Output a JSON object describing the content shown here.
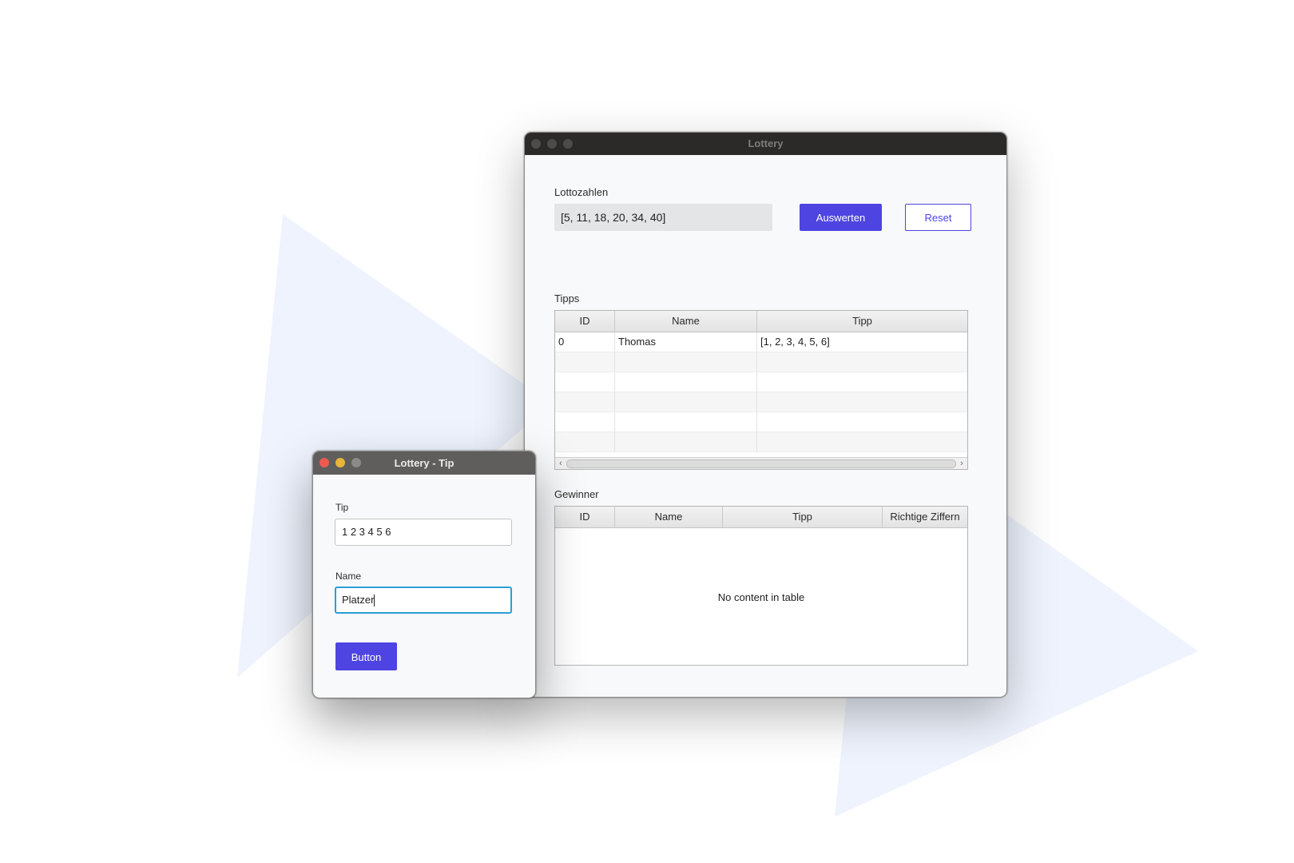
{
  "main_window": {
    "title": "Lottery",
    "lottozahlen_label": "Lottozahlen",
    "lottozahlen_value": "[5, 11, 18, 20, 34, 40]",
    "auswerten_button": "Auswerten",
    "reset_button": "Reset",
    "tipps_label": "Tipps",
    "tipps_table": {
      "columns": [
        "ID",
        "Name",
        "Tipp"
      ],
      "rows": [
        [
          "0",
          "Thomas",
          "[1, 2, 3, 4, 5, 6]"
        ]
      ]
    },
    "gewinner_label": "Gewinner",
    "gewinner_table": {
      "columns": [
        "ID",
        "Name",
        "Tipp",
        "Richtige Ziffern"
      ],
      "empty_message": "No content in table"
    }
  },
  "tip_window": {
    "title": "Lottery - Tip",
    "tip_label": "Tip",
    "tip_value": "1 2 3 4 5 6",
    "name_label": "Name",
    "name_value": "Platzer",
    "submit_button": "Button"
  },
  "colors": {
    "accent": "#4e44e2",
    "background_shape": "#eef3fd",
    "focus_ring": "#2a9fd6"
  }
}
